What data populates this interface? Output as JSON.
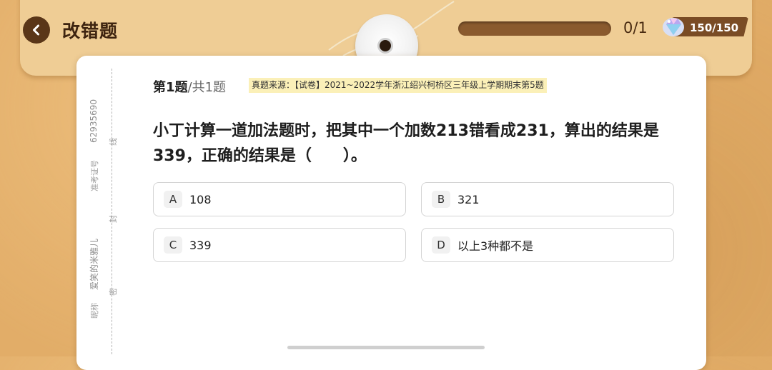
{
  "header": {
    "title": "改错题",
    "progress_text": "0/1",
    "progress_fraction": 0,
    "gems_text": "150/150"
  },
  "sheet_margin": {
    "exam_id_label": "准考证号",
    "exam_id": "62935690",
    "nickname_label": "昵称",
    "nickname": "爱笑的米雅儿",
    "seal_marks": [
      "线",
      "封",
      "密"
    ]
  },
  "question": {
    "number": "第1题",
    "total": "/共1题",
    "source": "真题来源：【试卷】2021~2022学年浙江绍兴柯桥区三年级上学期期末第5题",
    "text": "小丁计算一道加法题时，把其中一个加数213错看成231，算出的结果是339，正确的结果是（　　）。",
    "options": [
      {
        "letter": "A",
        "text": "108"
      },
      {
        "letter": "B",
        "text": "321"
      },
      {
        "letter": "C",
        "text": "339"
      },
      {
        "letter": "D",
        "text": "以上3种都不是"
      }
    ]
  },
  "colors": {
    "background": "#e2ad68",
    "panel": "#efcd95",
    "accent_dark": "#5a3618",
    "source_highlight": "#fbf0b8"
  },
  "icons": [
    "back-arrow-icon",
    "gem-icon"
  ]
}
